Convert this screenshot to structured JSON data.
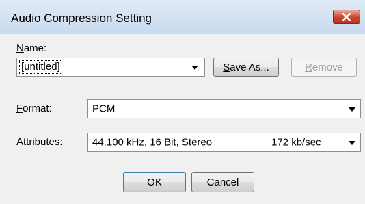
{
  "window": {
    "title": "Audio Compression Setting",
    "close_icon": "close-icon"
  },
  "name_section": {
    "label": "Name:",
    "value": "[untitled]",
    "save_as_label": "Save As...",
    "remove_label": "Remove"
  },
  "format": {
    "label": "Format:",
    "value": "PCM"
  },
  "attributes": {
    "label": "Attributes:",
    "value": "44.100 kHz, 16 Bit, Stereo",
    "rate": "172 kb/sec"
  },
  "buttons": {
    "ok_label": "OK",
    "cancel_label": "Cancel"
  },
  "colors": {
    "titlebar": "#c9daee",
    "close": "#c9452d",
    "default_button_border": "#3c7fb1"
  }
}
